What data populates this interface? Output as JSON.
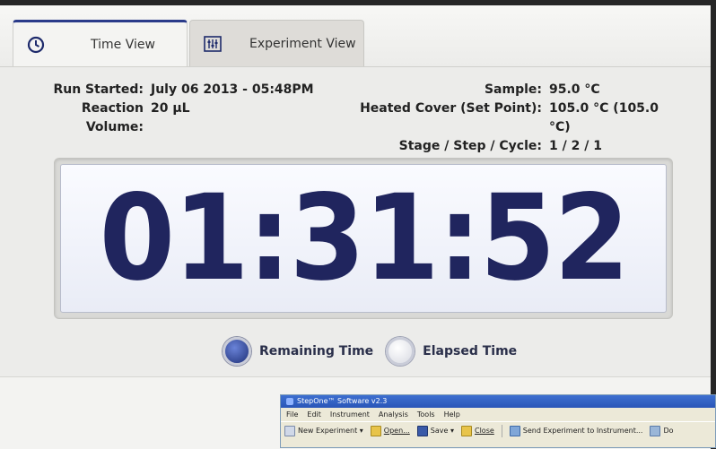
{
  "tabs": {
    "time_view": "Time View",
    "experiment_view": "Experiment View"
  },
  "run_info": {
    "run_started_label": "Run Started:",
    "run_started_value": "July 06 2013 - 05:48PM",
    "reaction_volume_label": "Reaction Volume:",
    "reaction_volume_value": "20 µL",
    "sample_label": "Sample:",
    "sample_value": "95.0 °C",
    "heated_cover_label": "Heated Cover (Set Point):",
    "heated_cover_value": "105.0 °C (105.0 °C)",
    "stage_label": "Stage / Step / Cycle:",
    "stage_value": "1 / 2 / 1"
  },
  "timer": {
    "display": "01:31:52"
  },
  "time_mode": {
    "remaining_label": "Remaining Time",
    "elapsed_label": "Elapsed Time",
    "selected": "remaining"
  },
  "software_window": {
    "title": "StepOne™ Software v2.3",
    "menu": [
      "File",
      "Edit",
      "Instrument",
      "Analysis",
      "Tools",
      "Help"
    ],
    "toolbar": {
      "new_experiment": "New Experiment",
      "open": "Open...",
      "save": "Save",
      "close": "Close",
      "send": "Send Experiment to Instrument...",
      "do": "Do"
    }
  },
  "colors": {
    "timer_text": "#20255e",
    "tab_accent": "#2a3b8a",
    "radio_selected": "#1f3178"
  }
}
